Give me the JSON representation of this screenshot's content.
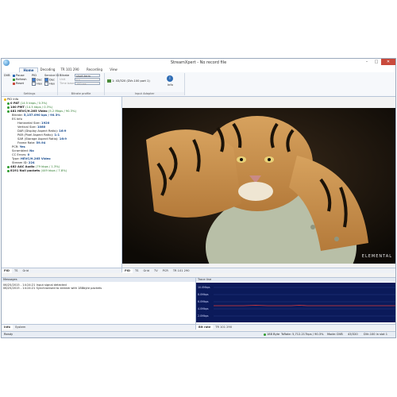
{
  "window": {
    "title": "StreamXpert - No record file"
  },
  "ribbon_tabs": [
    "Home",
    "Decoding",
    "TR 101 290",
    "Recording",
    "View"
  ],
  "ribbon": {
    "dvb_label": "DVB",
    "pause": "Pause",
    "refresh": "Refresh",
    "reset": "Reset",
    "pid_label": "PID",
    "service_id_label": "Service ID",
    "dec": "Dec",
    "hex": "Hex",
    "bitrate_label": "Bitrate",
    "bitrate_value": "short-term",
    "unit_label": "Unit",
    "unit_value": "k s",
    "time_base_label": "Time base",
    "time_base_value": "100 ms",
    "adapter_text": "1: 43/320 (DVr-100 port 1)",
    "info_label": "Info",
    "groups": [
      "Settings",
      "Bitrate profile",
      "Input Adapter"
    ]
  },
  "tree": {
    "root": "PID Info",
    "rows": [
      {
        "text": "0  PAT",
        "detail": "(14.5 kbps / 0.3%)"
      },
      {
        "text": "100  PMT",
        "detail": "(14.5 kbps / 0.3%)"
      },
      {
        "text": "481  HEVC/H.265 Video",
        "detail": "(5.2 Mbps / 90.3%)"
      },
      {
        "text": "Bitrate:",
        "detail": "5,157.090 kps / 90.3%"
      },
      {
        "text": "ES Info",
        "detail": ""
      },
      {
        "text": "Horizontal Size:",
        "detail": "1920"
      },
      {
        "text": "Vertical Size:",
        "detail": "1080"
      },
      {
        "text": "DAR (Display Aspect Ratio):",
        "detail": "16:9"
      },
      {
        "text": "PAR (Pixel Aspect Ratio):",
        "detail": "1:1"
      },
      {
        "text": "SAR (Storage Aspect Ratio):",
        "detail": "16:9"
      },
      {
        "text": "Frame Rate:",
        "detail": "59.94"
      },
      {
        "text": "PCR:",
        "detail": "Yes"
      },
      {
        "text": "Scrambled:",
        "detail": "No"
      },
      {
        "text": "CC Errors:",
        "detail": "0"
      },
      {
        "text": "Type:",
        "detail": "HEVC/H.265 Video"
      },
      {
        "text": "Stream ID:",
        "detail": "224"
      },
      {
        "text": "482  AAC Audio",
        "detail": "(79 kbps / 1.3%)"
      },
      {
        "text": "8191  Null packets",
        "detail": "(449 kbps / 7.8%)"
      }
    ]
  },
  "left_tabs": [
    "PID",
    "TS",
    "Grid"
  ],
  "video_tabs": [
    "PID",
    "TS",
    "Grid",
    "TV",
    "PCR",
    "TR 101 290"
  ],
  "video": {
    "watermark": "ELEMENTAL"
  },
  "messages": {
    "title": "Messages",
    "lines": [
      "06/25/2015 - 14:24:21 Input signal detected",
      "06/25/2015 - 14:24:21 Synchronised to stream with 188byte packets"
    ],
    "tabs": [
      "Info",
      "System"
    ]
  },
  "trace": {
    "title": "Trace line",
    "ylabels": [
      "10.0Mbps",
      "8.0Mbps",
      "6.0Mbps",
      "4.0Mbps",
      "2.0Mbps"
    ],
    "tabs": [
      "Bit rate",
      "TR 101 290"
    ]
  },
  "status": {
    "left": "Ready",
    "packets": "188 Byte",
    "totals": "TsRate: 5,712.217kps / 90.3%",
    "mode": "Mode: DVB",
    "adapter": "43/320",
    "port": "DVr-100 in slot 1"
  },
  "colors": {
    "accent": "#2f6db5",
    "trace_bg": "#0b1a5a",
    "trace_line": "#e03a3a"
  }
}
